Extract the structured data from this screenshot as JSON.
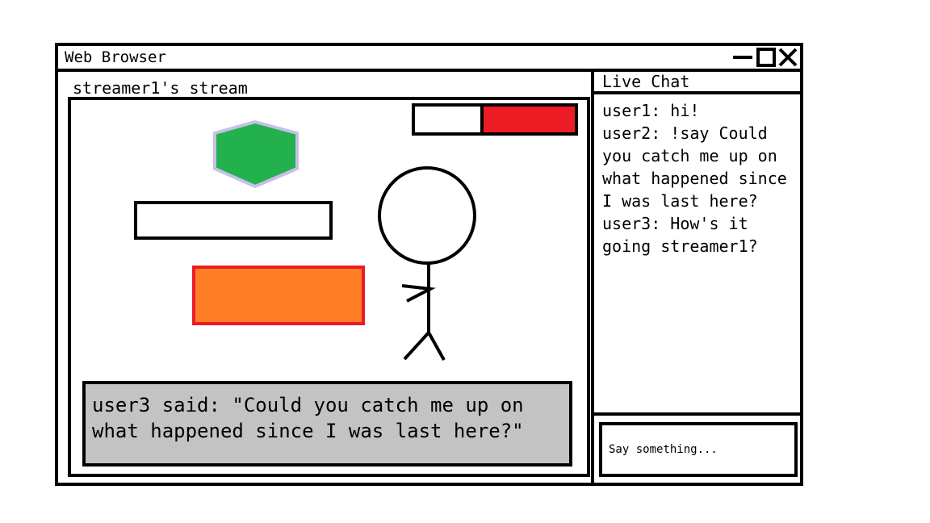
{
  "window": {
    "title": "Web Browser",
    "controls": {
      "minimize_icon": "minimize-icon",
      "maximize_icon": "maximize-icon",
      "close_icon": "close-icon"
    }
  },
  "stream": {
    "title": "streamer1's stream",
    "health_bar": {
      "filled_fraction": 0.57,
      "fill_color": "#ed1c24",
      "empty_color": "#ffffff"
    },
    "hexagon": {
      "fill": "#22b14c",
      "stroke": "#c8bfe7"
    },
    "white_platform": {
      "fill": "#ffffff",
      "stroke": "#000000"
    },
    "orange_block": {
      "fill": "#ff7f27",
      "stroke": "#ed1c24"
    },
    "caption": "user3 said: \"Could you catch me up on what happened since I was last here?\"",
    "caption_bg": "#c3c3c3"
  },
  "chat": {
    "title": "Live Chat",
    "messages": [
      {
        "text": "user1: hi!"
      },
      {
        "text": "user2: !say Could you catch me up on what happened since I was last here?"
      },
      {
        "text": "user3: How's it going streamer1?"
      }
    ],
    "input": {
      "placeholder": "Say something...",
      "value": ""
    }
  }
}
